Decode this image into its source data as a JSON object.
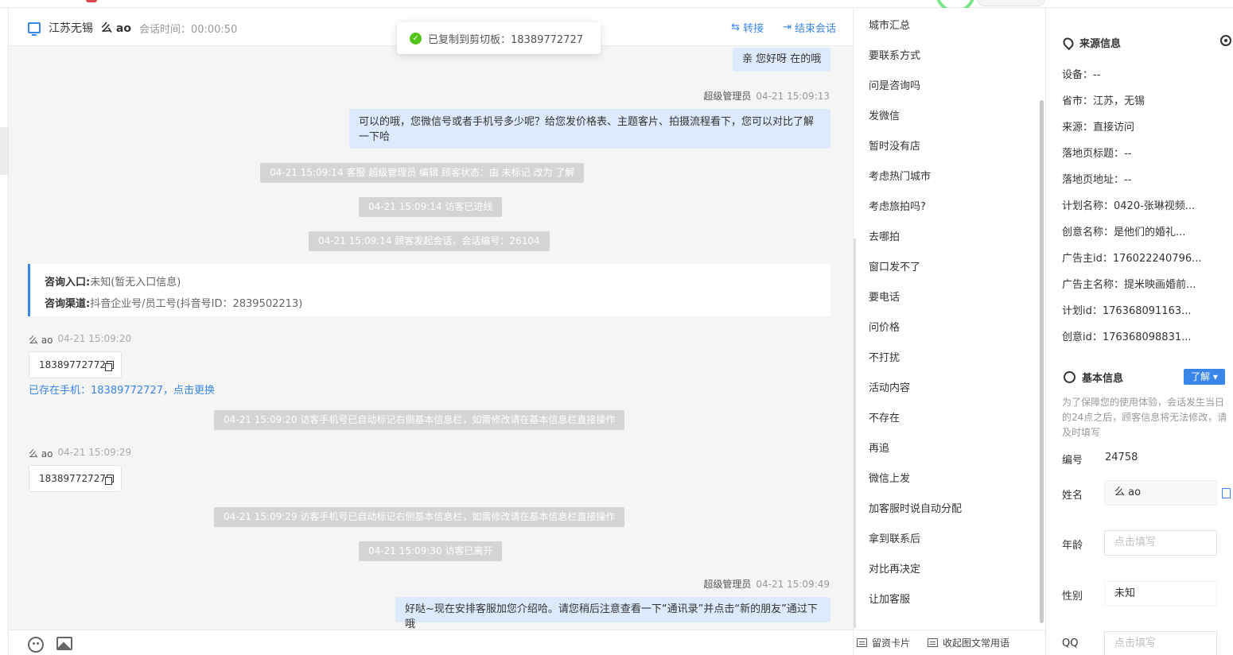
{
  "header": {
    "location": "江苏无锡",
    "visitor_name": "么 ao",
    "session_time": "会话时间：00:00:50",
    "transfer": "转接",
    "end_session": "结束会话"
  },
  "toast": "已复制到剪切板：18389772727",
  "messages": {
    "agent_reply_1": "亲 您好呀 在的哦",
    "agent_meta_1_name": "超级管理员",
    "agent_meta_1_time": "04-21 15:09:13",
    "agent_reply_2": "可以的哦，您微信号或者手机号多少呢？给您发价格表、主题客片、拍摄流程看下，您可以对比了解一下哈",
    "sys_1": "04-21 15:09:14 客服 超级管理员 编辑 顾客状态：由 未标记 改为 了解",
    "sys_2": "04-21 15:09:14 访客已进线",
    "sys_3": "04-21 15:09:14 顾客发起会话，会话编号：26104",
    "entry_label": "咨询入口:",
    "entry_value": "未知(暂无入口信息)",
    "channel_label": "咨询渠道:",
    "channel_value": "抖音企业号/员工号(抖音号ID：2839502213)",
    "visitor_name_1": "么 ao",
    "visitor_time_1": "04-21 15:09:20",
    "visitor_msg_1": "18389772772",
    "phone_link": "已存在手机：18389772727，点击更换",
    "sys_4": "04-21 15:09:20 访客手机号已自动标记右侧基本信息栏，如需修改请在基本信息栏直接操作",
    "visitor_name_2": "么 ao",
    "visitor_time_2": "04-21 15:09:29",
    "visitor_msg_2": "18389772727",
    "sys_5": "04-21 15:09:29 访客手机号已自动标记右侧基本信息栏，如需修改请在基本信息栏直接操作",
    "sys_6": "04-21 15:09:30 访客已离开",
    "agent_meta_2_name": "超级管理员",
    "agent_meta_2_time": "04-21 15:09:49",
    "agent_reply_3": "好哒~现在安排客服加您介绍哈。请您稍后注意查看一下“通讯录”并点击“新的朋友”通过下哦"
  },
  "phrases": [
    "城市汇总",
    "要联系方式",
    "问是咨询吗",
    "发微信",
    "暂时没有店",
    "考虑热门城市",
    "考虑旅拍吗?",
    "去哪拍",
    "窗口发不了",
    "要电话",
    "问价格",
    "不打扰",
    "活动内容",
    "不存在",
    "再追",
    "微信上发",
    "加客服时说自动分配",
    "拿到联系后",
    "对比再决定",
    "让加客服"
  ],
  "phrase_footer": {
    "card": "留资卡片",
    "collapse": "收起图文常用语"
  },
  "source": {
    "title": "来源信息",
    "rows": [
      "设备：--",
      "省市：江苏，无锡",
      "来源：直接访问",
      "落地页标题：--",
      "落地页地址：--",
      "计划名称：0420-张琳视频...",
      "创意名称：是他们的婚礼...",
      "广告主id：176022240796...",
      "广告主名称：提米映画婚前...",
      "计划id：176368091163...",
      "创意id：176368098831..."
    ]
  },
  "basic": {
    "title": "基本信息",
    "badge": "了解 ▾",
    "notice": "为了保障您的使用体验，会话发生当日的24点之后，顾客信息将无法修改，请及时填写",
    "id_label": "编号",
    "id_value": "24758",
    "name_label": "姓名",
    "name_value": "么 ao",
    "age_label": "年龄",
    "age_placeholder": "点击填写",
    "gender_label": "性别",
    "gender_value": "未知",
    "qq_label": "QQ",
    "qq_placeholder": "点击填写"
  }
}
